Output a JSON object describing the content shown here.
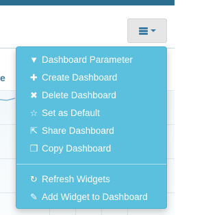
{
  "header": {
    "menu_button_icon": "bars-icon",
    "caret_icon": "caret-down-icon"
  },
  "panel": {
    "title_fragment": "e"
  },
  "dropdown": {
    "items": [
      {
        "label": "Dashboard Parameter",
        "icon": "filter-icon",
        "glyph": "▼"
      },
      {
        "label": "Create Dashboard",
        "icon": "plus-icon",
        "glyph": "✚"
      },
      {
        "label": "Delete Dashboard",
        "icon": "close-icon",
        "glyph": "✖"
      },
      {
        "label": "Set as Default",
        "icon": "star-icon",
        "glyph": "☆"
      },
      {
        "label": "Share Dashboard",
        "icon": "share-icon",
        "glyph": "⇱"
      },
      {
        "label": "Copy Dashboard",
        "icon": "copy-icon",
        "glyph": "❐"
      }
    ],
    "items_after_divider": [
      {
        "label": "Refresh Widgets",
        "icon": "refresh-icon",
        "glyph": "↻"
      },
      {
        "label": "Add Widget to Dashboard",
        "icon": "edit-icon",
        "glyph": "✎"
      }
    ]
  },
  "colors": {
    "dropdown_bg": "#5bc0de",
    "top_bar": "#2c6e8f",
    "accent": "#3a7ca5"
  }
}
